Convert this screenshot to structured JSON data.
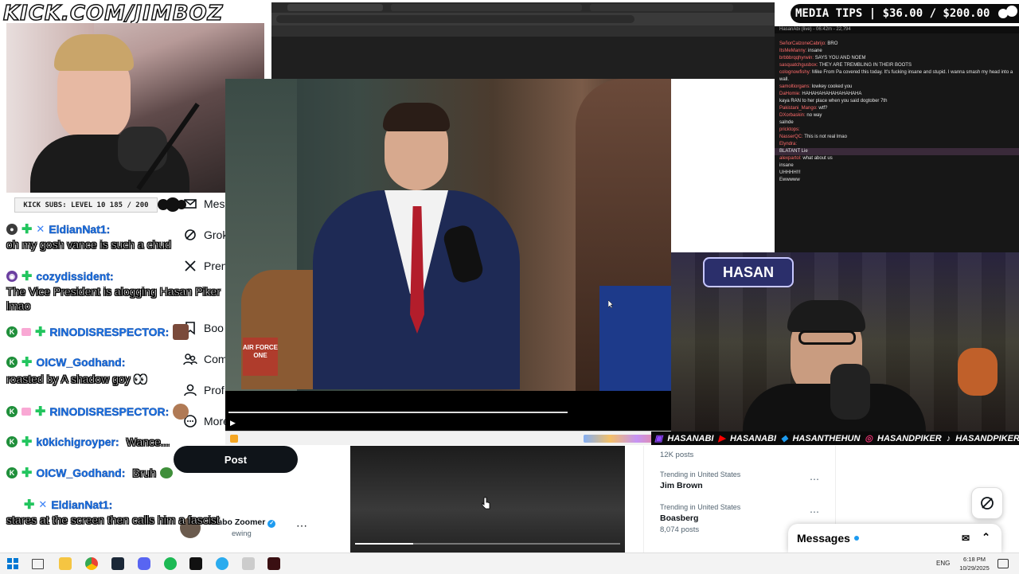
{
  "overlay": {
    "watermark": "KICK.COM/JIMBOZ",
    "subs_bar": "KICK SUBS: LEVEL 10 185 / 200",
    "media_tips": "MEDIA TIPS | $36.00 / $200.00"
  },
  "kick_chat": [
    {
      "user": "EldianNat1:",
      "text": "oh my gosh vance is such a chud",
      "badge_color": "#3b3b3b",
      "badge": "●"
    },
    {
      "user": "cozydissident:",
      "text": "The Vice President is alogging Hasan Piker lmao",
      "badge_color": "#6b3fa0",
      "badge": "◉"
    },
    {
      "user": "RINODISRESPECTOR:",
      "text": "",
      "badge_color": "#1f8f3a",
      "badge": "K"
    },
    {
      "user": "OICW_Godhand:",
      "text": "roasted by A shadow goy",
      "badge_color": "#1f8f3a",
      "badge": "K"
    },
    {
      "user": "RINODISRESPECTOR:",
      "text": "",
      "badge_color": "#1f8f3a",
      "badge": "K"
    },
    {
      "user": "k0kichigroyper:",
      "text": "Wance...",
      "badge_color": "#1f8f3a",
      "badge": "K"
    },
    {
      "user": "OICW_Godhand:",
      "text": "Bruh",
      "badge_color": "#1f8f3a",
      "badge": "K"
    },
    {
      "user": "EldianNat1:",
      "text": "stares at the screen then calls him a fascist",
      "badge_color": "#3b3b3b",
      "badge": ""
    }
  ],
  "x_nav": {
    "messages": "Mes",
    "grok": "Grok",
    "premium": "Pren",
    "bookmarks": "Boo",
    "communities": "Com",
    "profile": "Prof",
    "more": "More",
    "post_button": "Post"
  },
  "x_profile": {
    "name": "Jimbo Zoomer",
    "sub": "ewing"
  },
  "trending": [
    {
      "context": "",
      "name": "",
      "posts": "12K posts"
    },
    {
      "context": "Trending in United States",
      "name": "Jim Brown",
      "posts": ""
    },
    {
      "context": "Trending in United States",
      "name": "Boasberg",
      "posts": "8,074 posts"
    }
  ],
  "x_messages": "Messages",
  "hasan_chat": [
    {
      "name": "",
      "text": ""
    },
    {
      "name": "SeñorCalzoneCabrijo:",
      "text": "BRO"
    },
    {
      "name": "ItsMeManny:",
      "text": "insane"
    },
    {
      "name": "brbbbrqqhyrwin:",
      "text": "SAYS YOU AND NOEM"
    },
    {
      "name": "sasquatchgusbox:",
      "text": "THEY ARE TREMBLING IN THEIR BOOTS"
    },
    {
      "name": "colognowfishy:",
      "text": "Mike From Pa covered this today. It's fucking insane and stupid. I wanna smash my head into a wall."
    },
    {
      "name": "samoltiorgans:",
      "text": "lowkey cooked you"
    },
    {
      "name": "DaHomie:",
      "text": "HAHAHAHAHAHAHAHAHA"
    },
    {
      "name": "",
      "text": "kaya RAN to her place when you said dogtober 7th"
    },
    {
      "name": "Pakistani_Mango:",
      "text": "wtf?"
    },
    {
      "name": "DXorbaskin:",
      "text": "no way"
    },
    {
      "name": "",
      "text": "salnde"
    },
    {
      "name": "pricktops:",
      "text": ""
    },
    {
      "name": "NasserQC:",
      "text": "This is not real lmao"
    },
    {
      "name": "Elyndra:",
      "text": ""
    },
    {
      "name": "",
      "text": "BLATANT Lie"
    },
    {
      "name": "alexpartol:",
      "text": "what about us"
    },
    {
      "name": "",
      "text": "insane"
    },
    {
      "name": "",
      "text": "UHHHH!!!"
    },
    {
      "name": "",
      "text": "Ewwwww"
    }
  ],
  "hasan_chat_header": "HasanAbi (live) - 06:42m - 22,794",
  "socials": [
    "HASANABI",
    "HASANABI",
    "HASANTHEHUN",
    "HASANDPIKER",
    "HASANDPIKER"
  ],
  "hasan_logo": "HASAN",
  "vid_logo": "AIR FORCE ONE",
  "taskbar": {
    "lang": "ENG",
    "time": "6:18 PM",
    "date": "10/29/2025"
  },
  "colors": {
    "kick_green": "#53fc18",
    "chat_blue": "#1a73e8",
    "x_black": "#0f1419"
  }
}
